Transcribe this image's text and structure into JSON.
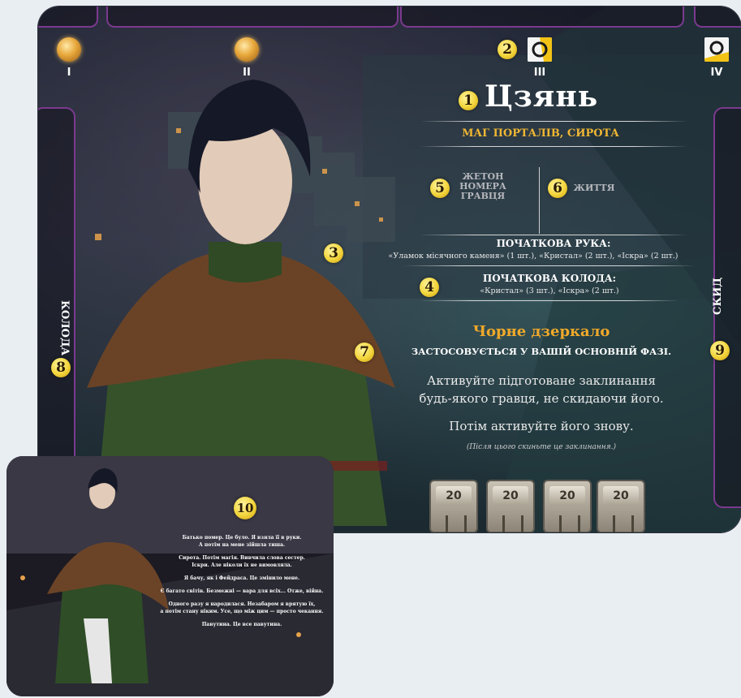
{
  "board": {
    "slots": [
      {
        "numeral": "I",
        "state": "open"
      },
      {
        "numeral": "II",
        "state": "open"
      },
      {
        "numeral": "III",
        "state": "closed"
      },
      {
        "numeral": "IV",
        "state": "closed"
      }
    ],
    "title": "Цзянь",
    "subtitle": "МАГ ПОРТАЛІВ, СИРОТА",
    "token_label": "ЖЕТОН НОМЕРА ГРАВЦЯ",
    "life_label": "ЖИТТЯ",
    "starting_hand_title": "ПОЧАТКОВА РУКА:",
    "starting_hand_text": "«Уламок місячного каменя» (1 шт.), «Кристал» (2 шт.), «Іскра» (2 шт.)",
    "starting_deck_title": "ПОЧАТКОВА КОЛОДА:",
    "starting_deck_text": "«Кристал» (3 шт.), «Іскра» (2 шт.)",
    "ability_name": "Чорне дзеркало",
    "ability_timing": "ЗАСТОСОВУЄТЬСЯ У ВАШІЙ ОСНОВНІЙ ФАЗІ.",
    "ability_text_1": "Активуйте підготоване заклинання",
    "ability_text_2": "будь-якого гравця, не скидаючи його.",
    "ability_text_3": "Потім активуйте його знову.",
    "ability_note": "(Після цього скиньте це заклинання.)",
    "charges": [
      "20",
      "20",
      "20",
      "20"
    ],
    "deck_label": "КОЛОДА",
    "discard_label": "СКИД"
  },
  "callouts": {
    "n1": "1",
    "n2": "2",
    "n3": "3",
    "n4": "4",
    "n5": "5",
    "n6": "6",
    "n7": "7",
    "n8": "8",
    "n9": "9",
    "n10": "10"
  },
  "back_card": {
    "lines": [
      "Батько помер. Це було. Я взяла її в руки.",
      "А потім на мене зійшла тиша.",
      "Сирота. Потім магія. Вивчила слова сестер.",
      "Іскри. Але ніколи їх не вимовляла.",
      "Я бачу, як і Фейдраса. Це змінило мене.",
      "Є багато світів. Безмежні — вара для всіх... Отже, війна.",
      "Одного разу я народилася. Незабаром я врятую їх,",
      "а потім стану ніким. Усе, що між цим — просто чекання.",
      "Павутина. Це все павутина."
    ]
  },
  "colors": {
    "accent_gold": "#f0b633",
    "ability_orange": "#f0a92a",
    "frame_purple": "#7b3a8f",
    "marker_yellow": "#f2d43a"
  }
}
